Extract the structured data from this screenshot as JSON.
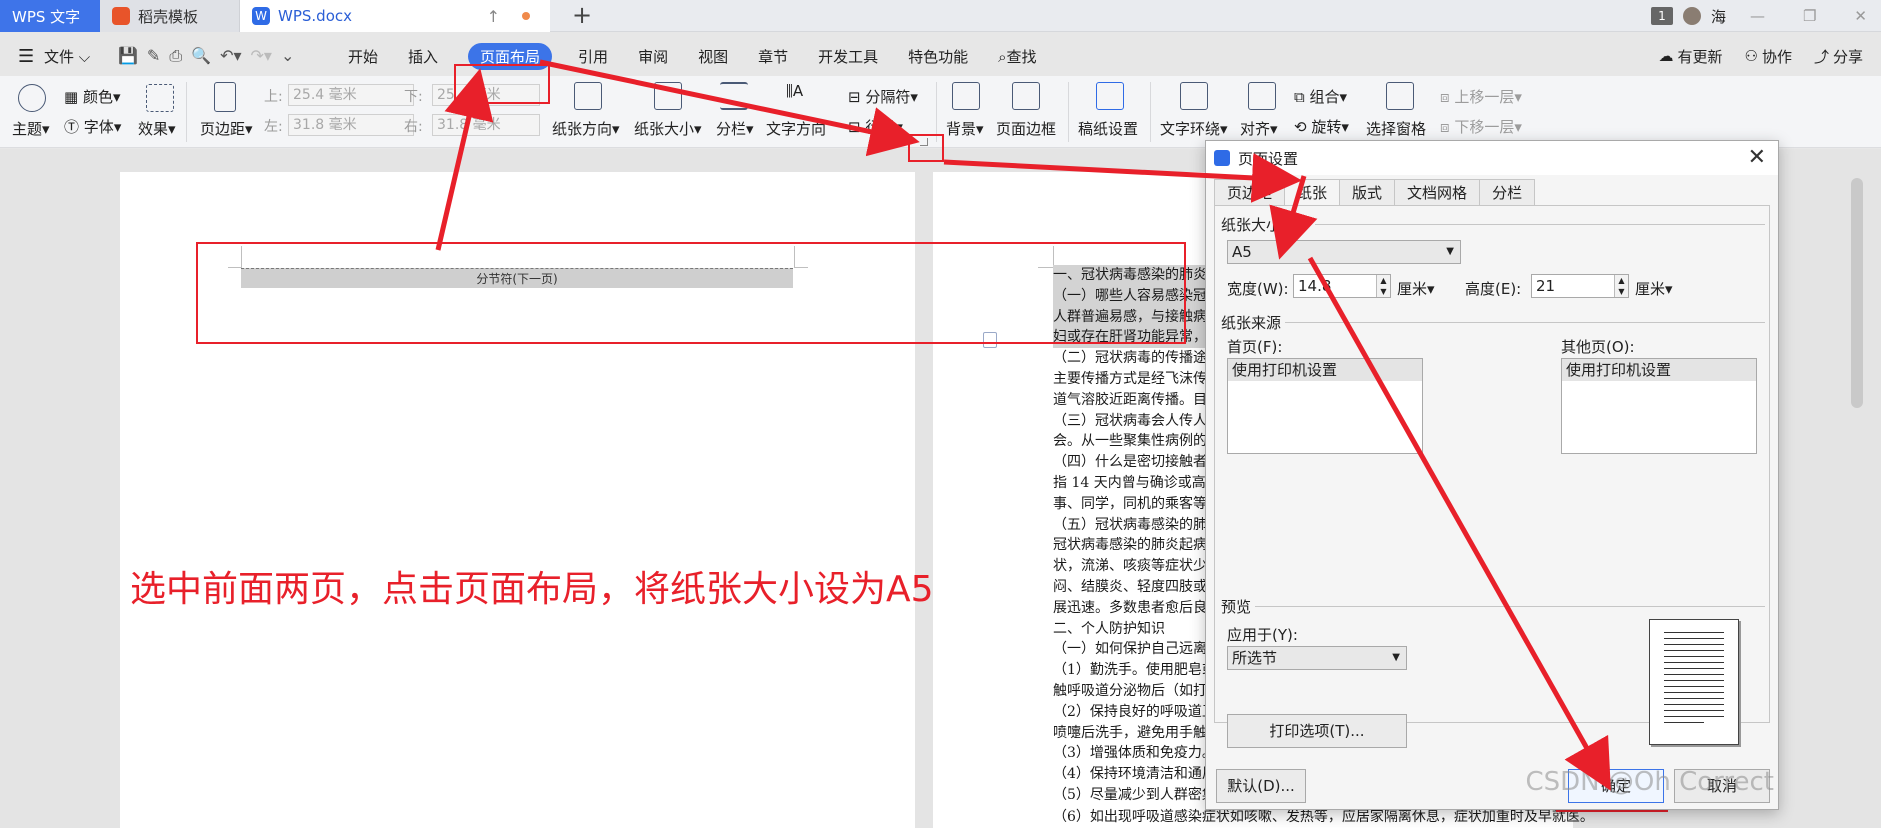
{
  "titlebar": {
    "app_tab": "WPS 文字",
    "template_tab": "稻壳模板",
    "doc_tab": "WPS.docx",
    "upload_symbol": "↑",
    "new_tab_symbol": "+",
    "account_count": "1",
    "user_name": "海"
  },
  "menubar": {
    "file": "文件",
    "items": [
      "开始",
      "插入",
      "页面布局",
      "引用",
      "审阅",
      "视图",
      "章节",
      "开发工具",
      "特色功能",
      "查找"
    ],
    "right": [
      "有更新",
      "协作",
      "分享"
    ]
  },
  "ribbon": {
    "theme": "主题",
    "color": "颜色",
    "font": "字体",
    "effect": "效果",
    "margins": "页边距",
    "top_label": "上:",
    "top_value": "25.4 毫米",
    "bottom_label": "下:",
    "bottom_value": "25.4 毫米",
    "left_label": "左:",
    "left_value": "31.8 毫米",
    "right_label": "右:",
    "right_value": "31.8 毫米",
    "orientation": "纸张方向",
    "size": "纸张大小",
    "columns": "分栏",
    "text_direction": "文字方向",
    "separator": "分隔符",
    "line_number": "行号",
    "background": "背景",
    "page_border": "页面边框",
    "draft_setting": "稿纸设置",
    "text_wrap": "文字环绕",
    "align": "对齐",
    "group": "组合",
    "rotate": "旋转",
    "selection_pane": "选择窗格",
    "bring_forward": "上移一层",
    "send_backward": "下移一层"
  },
  "document": {
    "section_break": "分节符(下一页)",
    "lines": [
      "一、冠状病毒感染的肺炎",
      "（一）哪些人容易感染冠",
      "人群普遍易感，与接触病",
      "妇或存在肝肾功能异常，",
      "（二）冠状病毒的传播途",
      "主要传播方式是经飞沫传",
      "道气溶胶近距离传播。目",
      "（三）冠状病毒会人传人",
      "会。从一些聚集性病例的",
      "（四）什么是密切接触者",
      "指 14 天内曾与确诊或高度",
      "事、同学，同机的乘客等",
      "（五）冠状病毒感染的肺",
      "冠状病毒感染的肺炎起病",
      "状，流涕、咳痰等症状少",
      "闷、结膜炎、轻度四肢或",
      "展迅速。多数患者愈后良",
      "二、个人防护知识",
      "（一）如何保护自己远离",
      "（1）勤洗手。使用肥皂或",
      "触呼吸道分泌物后（如打",
      "（2）保持良好的呼吸道卫",
      "喷嚏后洗手，避免用手触",
      "（3）增强体质和免疫力。",
      "（4）保持环境清洁和通风",
      "（5）尽量减少到人群密集",
      "（6）如出现呼吸道感染症状如咳嗽、发热等，应居家隔离休息，症状加重时及早就医。"
    ]
  },
  "annotation": {
    "text": "选中前面两页，点击页面布局，将纸张大小设为A5"
  },
  "dialog": {
    "title": "页面设置",
    "close_symbol": "✕",
    "tabs": [
      "页边距",
      "纸张",
      "版式",
      "文档网格",
      "分栏"
    ],
    "paper_size_group": "纸张大小(R)",
    "paper_size_value": "A5",
    "width_label": "宽度(W):",
    "width_value": "14.8",
    "height_label": "高度(E):",
    "height_value": "21",
    "unit": "厘米",
    "paper_source_group": "纸张来源",
    "first_page_label": "首页(F):",
    "first_page_value": "使用打印机设置",
    "other_pages_label": "其他页(O):",
    "other_pages_value": "使用打印机设置",
    "preview_group": "预览",
    "apply_to_label": "应用于(Y):",
    "apply_to_value": "所选节",
    "print_options": "打印选项(T)...",
    "default_button": "默认(D)...",
    "ok_button": "确定",
    "cancel_button": "取消"
  },
  "watermark": "CSDN @Oh Correct",
  "colors": {
    "accent": "#3c74e8",
    "annotation_red": "#e8202a",
    "wps_tab": "#3e74e9"
  }
}
